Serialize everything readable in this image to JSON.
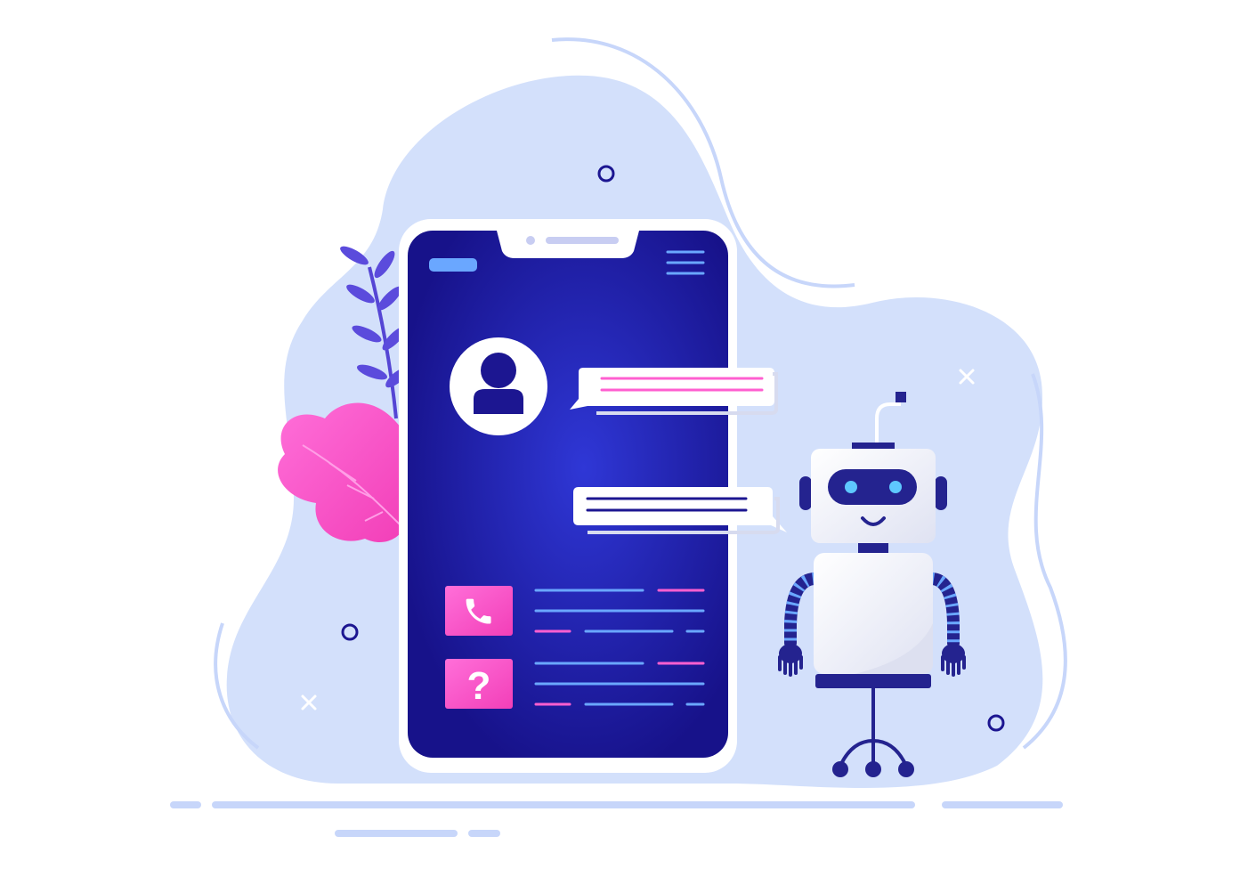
{
  "illustration": {
    "subject": "chatbot-conversation",
    "icons": [
      "phone-icon",
      "question-icon",
      "user-icon",
      "menu-icon",
      "robot-icon",
      "leaf-icon"
    ],
    "palette": {
      "background": "#ffffff",
      "blob": "#cfdcfb",
      "blob_outline": "#c4d4fb",
      "phone_frame": "#ffffff",
      "screen": "#1c1691",
      "screen_glow": "#2a30c4",
      "accent_pink": "#ff5fd0",
      "accent_blue": "#6aa7ff",
      "robot_body": "#f4f5fb",
      "robot_dark": "#24238f",
      "robot_eyes": "#5ec8ff",
      "leaf_pink": "#ff4fc8",
      "leaf_purple": "#5545d4"
    },
    "question_glyph": "?"
  }
}
